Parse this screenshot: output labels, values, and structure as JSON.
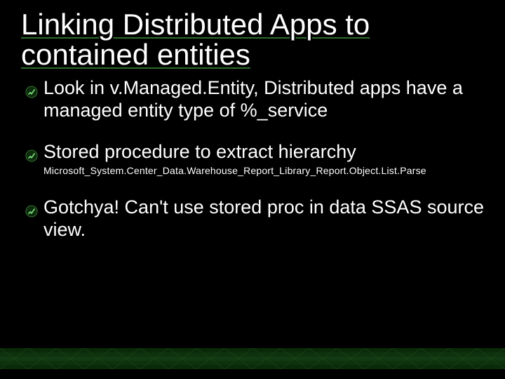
{
  "title": "Linking Distributed Apps to contained entities",
  "bullets": [
    {
      "text": "Look in v.Managed.Entity, Distributed apps have a managed entity type of %_service",
      "sub": null
    },
    {
      "text": "Stored procedure to extract hierarchy",
      "sub": "Microsoft_System.Center_Data.Warehouse_Report_Library_Report.Object.List.Parse"
    },
    {
      "text": "Gotchya! Can't use stored proc in data SSAS source view.",
      "sub": null
    }
  ]
}
